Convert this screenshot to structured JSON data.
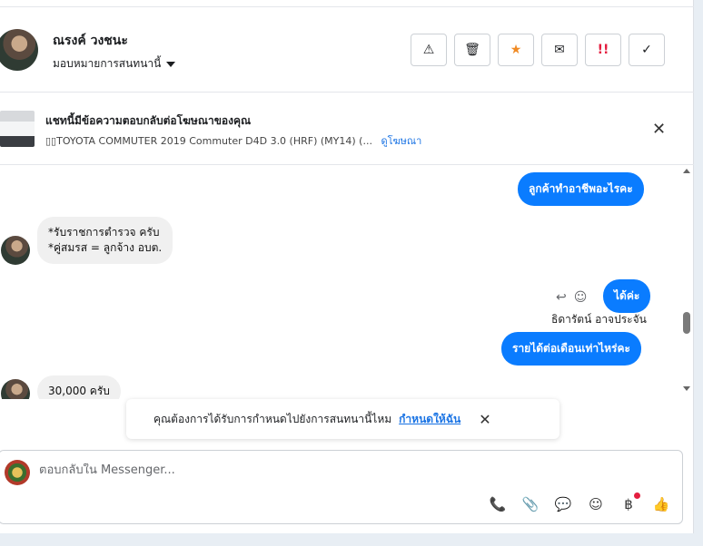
{
  "header": {
    "user_name": "ณรงค์ วงชนะ",
    "assign_label": "มอบหมายการสนทนานี้",
    "actions": [
      {
        "name": "spam",
        "glyph": "⚠"
      },
      {
        "name": "delete",
        "glyph": "🗑"
      },
      {
        "name": "star",
        "glyph": "★"
      },
      {
        "name": "mail",
        "glyph": "✉"
      },
      {
        "name": "urgent",
        "glyph": "!!"
      },
      {
        "name": "done",
        "glyph": "✓"
      }
    ]
  },
  "ad_bar": {
    "title": "แชทนี้มีข้อความตอบกลับต่อโฆษณาของคุณ",
    "subtitle": "▯▯TOYOTA COMMUTER 2019 Commuter D4D 3.0 (HRF) (MY14) (...",
    "link": "ดูโฆษณา",
    "close": "✕"
  },
  "messages": {
    "out_1": "ลูกค้าทำอาชีพอะไรคะ",
    "in_1": "*รับราชการตำรวจ ครับ\n*คู่สมรส = ลูกจ้าง อบต.",
    "out_2": "ได้ค่ะ",
    "sender": "ธิดารัตน์ อาจประจัน",
    "out_3": "รายได้ต่อเดือนเท่าไหร่คะ",
    "in_2": "30,000 ครับ"
  },
  "toast": {
    "text": "คุณต้องการได้รับการกำหนดไปยังการสนทนานี้ไหม",
    "link": "กำหนดให้ฉัน",
    "close": "✕"
  },
  "composer": {
    "placeholder": "ตอบกลับใน Messenger...",
    "tools": [
      "📞",
      "📎",
      "💬",
      "☺",
      "฿",
      "👍"
    ]
  },
  "colors": {
    "accent": "#0a7cff",
    "link": "#1b74e4",
    "incoming_bubble": "#f0f0f0",
    "star": "#f08a24",
    "urgent": "#e41e3f"
  }
}
